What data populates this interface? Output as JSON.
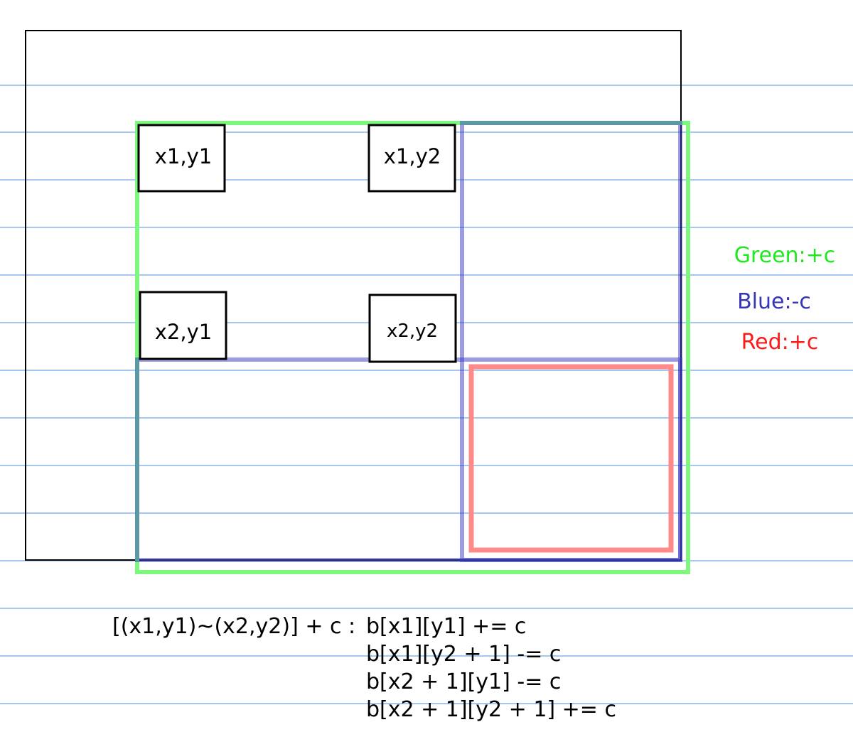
{
  "colors": {
    "ruled_line": "#4a90e2",
    "outer_border": "#000000",
    "green": "#2ee82e",
    "blue": "#3333bb",
    "red": "#ff2020",
    "green_rect": "#7ff77f",
    "blue_rect": "#8f8fe0",
    "red_rect": "#ff8a8a"
  },
  "corners": [
    {
      "id": "x1y1",
      "label": "x1,y1"
    },
    {
      "id": "x1y2",
      "label": "x1,y2"
    },
    {
      "id": "x2y1",
      "label": "x2,y1"
    },
    {
      "id": "x2y2",
      "label": "x2,y2"
    }
  ],
  "legend": {
    "green": "Green:+c",
    "blue": "Blue:-c",
    "red": "Red:+c"
  },
  "formula": {
    "prefix": "[(x1,y1)~(x2,y2)] + c : ",
    "lines": [
      "b[x1][y1] += c",
      "b[x1][y2 + 1] -= c",
      "b[x2 + 1][y1] -= c",
      "b[x2 + 1][y2 + 1] += c"
    ]
  }
}
